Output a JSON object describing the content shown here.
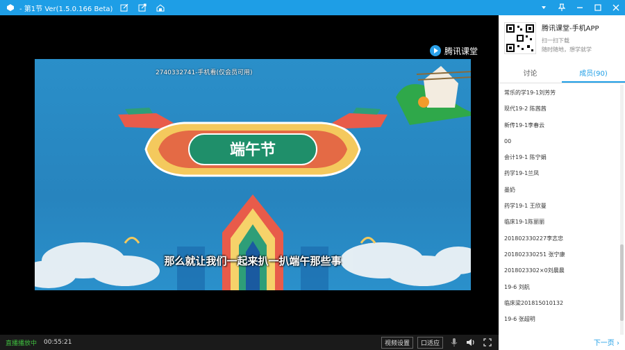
{
  "window": {
    "title": "- 第1节 Ver(1.5.0.166 Beta)"
  },
  "video": {
    "brand": "腾讯课堂",
    "overlay_id": "2740332741-手机看(仅会员可用)",
    "subtitle": "那么就让我们一起来扒一扒端午那些事",
    "banner_text": "端午节"
  },
  "bottombar": {
    "live_status": "直播播放中",
    "time": "00:55:21",
    "video_settings": "视频设置",
    "fit_button": "口适应"
  },
  "sidebar": {
    "promo_title": "腾讯课堂-手机APP",
    "promo_sub": "扫一扫下载",
    "promo_sub2": "随时随地，想学就学",
    "tabs": [
      {
        "label": "讨论",
        "active": false
      },
      {
        "label": "成员(90)",
        "active": true
      }
    ],
    "members": [
      "常乐的学19-1刘芳芳",
      "现代19-2 陈茜茜",
      "新传19-1李春云",
      "00",
      "会计19-1 陈宁娟",
      "药学19-1兰凤",
      "墨奶",
      "药学19-1 王欣曼",
      "临床19-1陈丽丽",
      "201802330227李志忠",
      "201802330251 张宁康",
      "2018023302×0刘晨晨",
      "19-6 刘航",
      "临床梁201815010132",
      "19-6 张超明"
    ],
    "next_page": "下一页"
  },
  "colors": {
    "titlebar": "#1e9ee6",
    "accent": "#1e9ee6",
    "live": "#3fbf3f"
  }
}
